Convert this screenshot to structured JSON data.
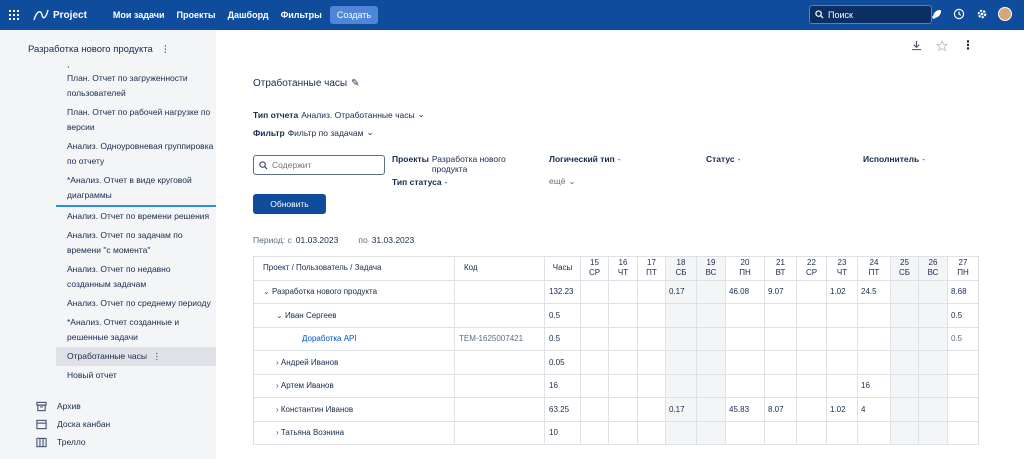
{
  "topbar": {
    "logo": "Project",
    "nav": [
      "Мои задачи",
      "Проекты",
      "Дашборд",
      "Фильтры"
    ],
    "create_label": "Создать",
    "search_placeholder": "Поиск"
  },
  "sidebar": {
    "project_title": "Разработка нового продукта",
    "items": [
      ",",
      "План. Отчет по загруженности пользователей",
      "План. Отчет по рабочей нагрузке по версии",
      "Анализ. Одноуровневая группировка по отчету",
      "*Анализ. Отчет в виде круговой диаграммы",
      "Анализ. Отчет по времени решения",
      "Анализ. Отчет по задачам по времени \"с момента\"",
      "Анализ. Отчет по недавно созданным задачам",
      "Анализ. Отчет по среднему периоду",
      "*Анализ. Отчет созданные и решенные задачи",
      "Отработанные часы",
      "Новый отчет"
    ],
    "bottom": [
      "Архив",
      "Доска канбан",
      "Трелло"
    ]
  },
  "main": {
    "title": "Отработанные часы",
    "report_type_label": "Тип отчета",
    "report_type_value": "Анализ. Отработанные часы",
    "filter_label": "Фильтр",
    "filter_value": "Фильтр по задачам",
    "content_placeholder": "Содержит",
    "projects_label": "Проекты",
    "projects_value": "Разработка нового продукта",
    "status_type_label": "Тип статуса",
    "status_type_value": "-",
    "logic_type_label": "Логический тип",
    "logic_type_value": "-",
    "more": "ещё",
    "status_label": "Статус",
    "status_value": "-",
    "assignee_label": "Исполнитель",
    "assignee_value": "-",
    "refresh": "Обновить",
    "period_label": "Период: с",
    "period_from": "01.03.2023",
    "period_to_label": "по",
    "period_to": "31.03.2023"
  },
  "table": {
    "col_project": "Проект / Пользователь / Задача",
    "col_code": "Код",
    "col_hours": "Часы",
    "days": [
      {
        "n": "15",
        "d": "СР"
      },
      {
        "n": "16",
        "d": "ЧТ"
      },
      {
        "n": "17",
        "d": "ПТ"
      },
      {
        "n": "18",
        "d": "СБ"
      },
      {
        "n": "19",
        "d": "ВС"
      },
      {
        "n": "20",
        "d": "ПН"
      },
      {
        "n": "21",
        "d": "ВТ"
      },
      {
        "n": "22",
        "d": "СР"
      },
      {
        "n": "23",
        "d": "ЧТ"
      },
      {
        "n": "24",
        "d": "ПТ"
      },
      {
        "n": "25",
        "d": "СБ"
      },
      {
        "n": "26",
        "d": "ВС"
      },
      {
        "n": "27",
        "d": "ПН"
      }
    ],
    "rows": [
      {
        "label": "Разработка нового продукта",
        "indent": 0,
        "caret": "down",
        "code": "",
        "hours": "132.23",
        "vals": [
          "",
          "",
          "",
          "0.17",
          "",
          "46.08",
          "9.07",
          "",
          "1.02",
          "24.5",
          "",
          "",
          "8.68"
        ]
      },
      {
        "label": "Иван Сергеев",
        "indent": 1,
        "caret": "down",
        "code": "",
        "hours": "0.5",
        "vals": [
          "",
          "",
          "",
          "",
          "",
          "",
          "",
          "",
          "",
          "",
          "",
          "",
          "0.5"
        ]
      },
      {
        "label": "Доработка API",
        "indent": 2,
        "caret": "",
        "code": "TEM-1625007421",
        "hours": "0.5",
        "link": true,
        "vals": [
          "",
          "",
          "",
          "",
          "",
          "",
          "",
          "",
          "",
          "",
          "",
          "",
          "0.5"
        ]
      },
      {
        "label": "Андрей Иванов",
        "indent": 1,
        "caret": "right",
        "code": "",
        "hours": "0.05",
        "vals": [
          "",
          "",
          "",
          "",
          "",
          "",
          "",
          "",
          "",
          "",
          "",
          "",
          ""
        ]
      },
      {
        "label": "Артем Иванов",
        "indent": 1,
        "caret": "right",
        "code": "",
        "hours": "16",
        "vals": [
          "",
          "",
          "",
          "",
          "",
          "",
          "",
          "",
          "",
          "16",
          "",
          "",
          ""
        ]
      },
      {
        "label": "Константин Иванов",
        "indent": 1,
        "caret": "right",
        "code": "",
        "hours": "63.25",
        "vals": [
          "",
          "",
          "",
          "0.17",
          "",
          "45.83",
          "8.07",
          "",
          "1.02",
          "4",
          "",
          "",
          ""
        ]
      },
      {
        "label": "Татьяна Вознина",
        "indent": 1,
        "caret": "right",
        "code": "",
        "hours": "10",
        "vals": [
          "",
          "",
          "",
          "",
          "",
          "",
          "",
          "",
          "",
          "",
          "",
          "",
          ""
        ]
      }
    ]
  }
}
